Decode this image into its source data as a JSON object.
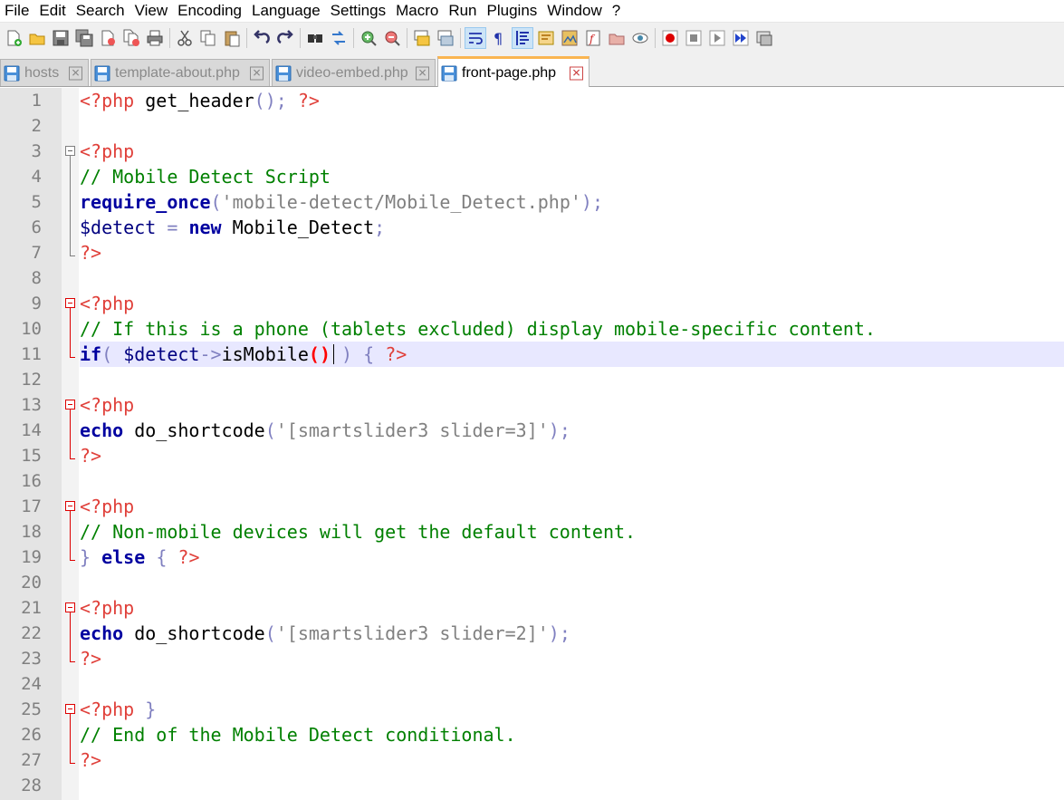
{
  "menu": [
    "File",
    "Edit",
    "Search",
    "View",
    "Encoding",
    "Language",
    "Settings",
    "Macro",
    "Run",
    "Plugins",
    "Window",
    "?"
  ],
  "toolbar": {
    "buttons": [
      "new-file-icon",
      "open-file-icon",
      "save-icon",
      "save-all-icon",
      "close-icon",
      "close-all-icon",
      "print-icon",
      "cut-icon",
      "copy-icon",
      "paste-icon",
      "undo-icon",
      "redo-icon",
      "find-icon",
      "replace-icon",
      "zoom-in-icon",
      "zoom-out-icon",
      "sync-vertical-icon",
      "sync-horizontal-icon",
      "word-wrap-icon",
      "show-all-characters-icon",
      "indent-guide-icon",
      "user-language-icon",
      "document-map-icon",
      "function-list-icon",
      "folder-as-workspace-icon",
      "monitoring-icon",
      "record-macro-icon",
      "stop-recording-icon",
      "play-macro-icon",
      "run-macro-multiple-icon",
      "save-macro-icon"
    ],
    "active": [
      "word-wrap-icon",
      "indent-guide-icon"
    ]
  },
  "tabs": [
    {
      "label": "hosts",
      "active": false
    },
    {
      "label": "template-about.php",
      "active": false
    },
    {
      "label": "video-embed.php",
      "active": false
    },
    {
      "label": "front-page.php",
      "active": true
    }
  ],
  "editor": {
    "current_line": 11,
    "lines": [
      {
        "n": "1",
        "tokens": [
          [
            "tag",
            "<?php"
          ],
          [
            "plain",
            " get_header"
          ],
          [
            "op",
            "();"
          ],
          [
            "plain",
            " "
          ],
          [
            "tag",
            "?>"
          ]
        ]
      },
      {
        "n": "2",
        "tokens": []
      },
      {
        "n": "3",
        "tokens": [
          [
            "tag",
            "<?php"
          ]
        ]
      },
      {
        "n": "4",
        "tokens": [
          [
            "cmt",
            "// Mobile Detect Script"
          ]
        ]
      },
      {
        "n": "5",
        "tokens": [
          [
            "kw",
            "require_once"
          ],
          [
            "op",
            "("
          ],
          [
            "str",
            "'mobile-detect/Mobile_Detect.php'"
          ],
          [
            "op",
            ");"
          ]
        ]
      },
      {
        "n": "6",
        "tokens": [
          [
            "var",
            "$detect"
          ],
          [
            "plain",
            " "
          ],
          [
            "op",
            "="
          ],
          [
            "plain",
            " "
          ],
          [
            "kw",
            "new"
          ],
          [
            "plain",
            " Mobile_Detect"
          ],
          [
            "op",
            ";"
          ]
        ]
      },
      {
        "n": "7",
        "tokens": [
          [
            "tag",
            "?>"
          ]
        ]
      },
      {
        "n": "8",
        "tokens": []
      },
      {
        "n": "9",
        "tokens": [
          [
            "tag",
            "<?php"
          ]
        ]
      },
      {
        "n": "10",
        "tokens": [
          [
            "cmt",
            "// If this is a phone (tablets excluded) display mobile-specific content."
          ]
        ]
      },
      {
        "n": "11",
        "tokens": [
          [
            "kw",
            "if"
          ],
          [
            "op",
            "("
          ],
          [
            "plain",
            " "
          ],
          [
            "var",
            "$detect"
          ],
          [
            "op",
            "->"
          ],
          [
            "plain",
            "isMobile"
          ],
          [
            "hl",
            "()"
          ],
          [
            "caret",
            ""
          ],
          [
            "plain",
            " "
          ],
          [
            "op",
            ")"
          ],
          [
            "plain",
            " "
          ],
          [
            "op",
            "{"
          ],
          [
            "plain",
            " "
          ],
          [
            "tag",
            "?>"
          ]
        ]
      },
      {
        "n": "12",
        "tokens": []
      },
      {
        "n": "13",
        "tokens": [
          [
            "tag",
            "<?php"
          ]
        ]
      },
      {
        "n": "14",
        "tokens": [
          [
            "kw",
            "echo"
          ],
          [
            "plain",
            " do_shortcode"
          ],
          [
            "op",
            "("
          ],
          [
            "str",
            "'[smartslider3 slider=3]'"
          ],
          [
            "op",
            ");"
          ]
        ]
      },
      {
        "n": "15",
        "tokens": [
          [
            "tag",
            "?>"
          ]
        ]
      },
      {
        "n": "16",
        "tokens": []
      },
      {
        "n": "17",
        "tokens": [
          [
            "tag",
            "<?php"
          ]
        ]
      },
      {
        "n": "18",
        "tokens": [
          [
            "cmt",
            "// Non-mobile devices will get the default content."
          ]
        ]
      },
      {
        "n": "19",
        "tokens": [
          [
            "op",
            "}"
          ],
          [
            "plain",
            " "
          ],
          [
            "kw",
            "else"
          ],
          [
            "plain",
            " "
          ],
          [
            "op",
            "{"
          ],
          [
            "plain",
            " "
          ],
          [
            "tag",
            "?>"
          ]
        ]
      },
      {
        "n": "20",
        "tokens": []
      },
      {
        "n": "21",
        "tokens": [
          [
            "tag",
            "<?php"
          ]
        ]
      },
      {
        "n": "22",
        "tokens": [
          [
            "kw",
            "echo"
          ],
          [
            "plain",
            " do_shortcode"
          ],
          [
            "op",
            "("
          ],
          [
            "str",
            "'[smartslider3 slider=2]'"
          ],
          [
            "op",
            ");"
          ]
        ]
      },
      {
        "n": "23",
        "tokens": [
          [
            "tag",
            "?>"
          ]
        ]
      },
      {
        "n": "24",
        "tokens": []
      },
      {
        "n": "25",
        "tokens": [
          [
            "tag",
            "<?php"
          ],
          [
            "plain",
            " "
          ],
          [
            "op",
            "}"
          ]
        ]
      },
      {
        "n": "26",
        "tokens": [
          [
            "cmt",
            "// End of the Mobile Detect conditional."
          ]
        ]
      },
      {
        "n": "27",
        "tokens": [
          [
            "tag",
            "?>"
          ]
        ]
      },
      {
        "n": "28",
        "tokens": []
      }
    ],
    "folds": [
      {
        "start": 3,
        "end": 7,
        "color": "gray"
      },
      {
        "start": 9,
        "end": 11,
        "color": "red"
      },
      {
        "start": 13,
        "end": 15,
        "color": "red"
      },
      {
        "start": 17,
        "end": 19,
        "color": "red"
      },
      {
        "start": 21,
        "end": 23,
        "color": "red"
      },
      {
        "start": 25,
        "end": 27,
        "color": "red"
      }
    ]
  }
}
